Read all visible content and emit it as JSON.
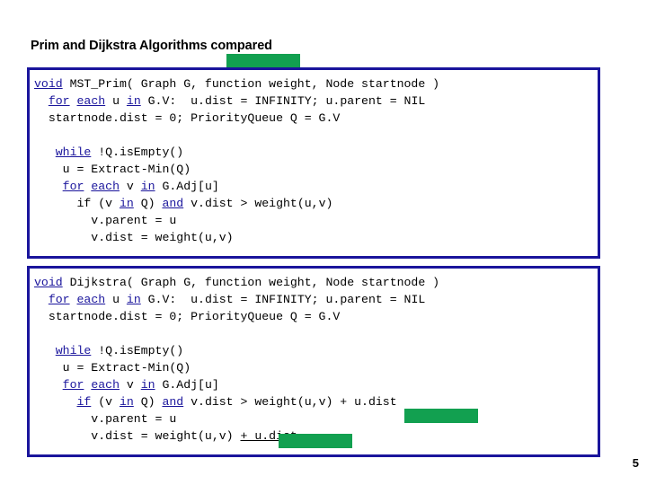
{
  "slide": {
    "title": "Prim and Dijkstra Algorithms compared",
    "page_number": "5",
    "accent_blue": "#1a159c",
    "highlight_green": "#12a050"
  },
  "code_blocks": [
    {
      "name": "prim",
      "lines": [
        [
          {
            "t": "void",
            "kw": true
          },
          {
            "t": " MST_Prim( Graph G, function weight, Node startnode )",
            "kw": false
          }
        ],
        [
          {
            "t": "  ",
            "kw": false
          },
          {
            "t": "for",
            "kw": true
          },
          {
            "t": " ",
            "kw": false
          },
          {
            "t": "each",
            "kw": true
          },
          {
            "t": " u ",
            "kw": false
          },
          {
            "t": "in",
            "kw": true
          },
          {
            "t": " G.V:  u.dist = INFINITY; u.parent = NIL",
            "kw": false
          }
        ],
        [
          {
            "t": "  startnode.dist = 0; PriorityQueue Q = G.V",
            "kw": false
          }
        ],
        [
          {
            "t": "",
            "kw": false
          }
        ],
        [
          {
            "t": "   ",
            "kw": false
          },
          {
            "t": "while",
            "kw": true
          },
          {
            "t": " !Q.isEmpty()",
            "kw": false
          }
        ],
        [
          {
            "t": "    u = Extract-Min(Q)",
            "kw": false
          }
        ],
        [
          {
            "t": "    ",
            "kw": false
          },
          {
            "t": "for",
            "kw": true
          },
          {
            "t": " ",
            "kw": false
          },
          {
            "t": "each",
            "kw": true
          },
          {
            "t": " v ",
            "kw": false
          },
          {
            "t": "in",
            "kw": true
          },
          {
            "t": " G.Adj[u]",
            "kw": false
          }
        ],
        [
          {
            "t": "      if (v ",
            "kw": false
          },
          {
            "t": "in",
            "kw": true
          },
          {
            "t": " Q) ",
            "kw": false
          },
          {
            "t": "and",
            "kw": true
          },
          {
            "t": " v.dist > weight(u,v)",
            "kw": false
          }
        ],
        [
          {
            "t": "        v.parent = u",
            "kw": false
          }
        ],
        [
          {
            "t": "        v.dist = weight(u,v)",
            "kw": false
          }
        ]
      ]
    },
    {
      "name": "dijkstra",
      "lines": [
        [
          {
            "t": "void",
            "kw": true
          },
          {
            "t": " Dijkstra( Graph G, function weight, Node startnode )",
            "kw": false
          }
        ],
        [
          {
            "t": "  ",
            "kw": false
          },
          {
            "t": "for",
            "kw": true
          },
          {
            "t": " ",
            "kw": false
          },
          {
            "t": "each",
            "kw": true
          },
          {
            "t": " u ",
            "kw": false
          },
          {
            "t": "in",
            "kw": true
          },
          {
            "t": " G.V:  u.dist = INFINITY; u.parent = NIL",
            "kw": false
          }
        ],
        [
          {
            "t": "  startnode.dist = 0; PriorityQueue Q = G.V",
            "kw": false
          }
        ],
        [
          {
            "t": "",
            "kw": false
          }
        ],
        [
          {
            "t": "   ",
            "kw": false
          },
          {
            "t": "while",
            "kw": true
          },
          {
            "t": " !Q.isEmpty()",
            "kw": false
          }
        ],
        [
          {
            "t": "    u = Extract-Min(Q)",
            "kw": false
          }
        ],
        [
          {
            "t": "    ",
            "kw": false
          },
          {
            "t": "for",
            "kw": true
          },
          {
            "t": " ",
            "kw": false
          },
          {
            "t": "each",
            "kw": true
          },
          {
            "t": " v ",
            "kw": false
          },
          {
            "t": "in",
            "kw": true
          },
          {
            "t": " G.Adj[u]",
            "kw": false
          }
        ],
        [
          {
            "t": "      ",
            "kw": false
          },
          {
            "t": "if",
            "kw": true
          },
          {
            "t": " (v ",
            "kw": false
          },
          {
            "t": "in",
            "kw": true
          },
          {
            "t": " Q) ",
            "kw": false
          },
          {
            "t": "and",
            "kw": true
          },
          {
            "t": " v.dist > weight(u,v) + u.dist",
            "kw": false
          }
        ],
        [
          {
            "t": "        v.parent = u",
            "kw": false
          }
        ],
        [
          {
            "t": "        v.dist = weight(u,v) ",
            "kw": false
          },
          {
            "t": "+ u.dist",
            "kw": false,
            "ul": true
          }
        ]
      ]
    }
  ]
}
